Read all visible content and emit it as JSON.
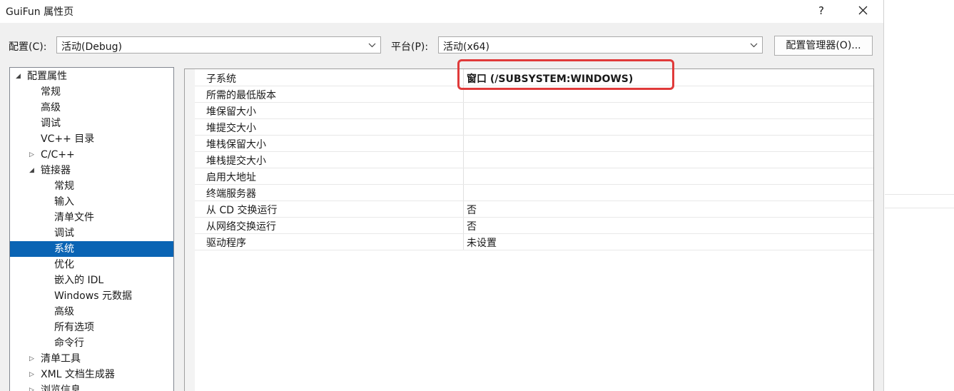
{
  "window": {
    "title": "GuiFun 属性页",
    "help_label": "?"
  },
  "toolbar": {
    "config_label": "配置(C):",
    "config_value": "活动(Debug)",
    "platform_label": "平台(P):",
    "platform_value": "活动(x64)",
    "manager_button": "配置管理器(O)..."
  },
  "tree": {
    "items": [
      {
        "label": "配置属性",
        "level": 0,
        "expander": "expanded"
      },
      {
        "label": "常规",
        "level": 1,
        "expander": "none"
      },
      {
        "label": "高级",
        "level": 1,
        "expander": "none"
      },
      {
        "label": "调试",
        "level": 1,
        "expander": "none"
      },
      {
        "label": "VC++ 目录",
        "level": 1,
        "expander": "none"
      },
      {
        "label": "C/C++",
        "level": 1,
        "expander": "collapsed"
      },
      {
        "label": "链接器",
        "level": 1,
        "expander": "expanded"
      },
      {
        "label": "常规",
        "level": 2,
        "expander": "none"
      },
      {
        "label": "输入",
        "level": 2,
        "expander": "none"
      },
      {
        "label": "清单文件",
        "level": 2,
        "expander": "none"
      },
      {
        "label": "调试",
        "level": 2,
        "expander": "none"
      },
      {
        "label": "系统",
        "level": 2,
        "expander": "none",
        "selected": true
      },
      {
        "label": "优化",
        "level": 2,
        "expander": "none"
      },
      {
        "label": "嵌入的 IDL",
        "level": 2,
        "expander": "none"
      },
      {
        "label": "Windows 元数据",
        "level": 2,
        "expander": "none"
      },
      {
        "label": "高级",
        "level": 2,
        "expander": "none"
      },
      {
        "label": "所有选项",
        "level": 2,
        "expander": "none"
      },
      {
        "label": "命令行",
        "level": 2,
        "expander": "none"
      },
      {
        "label": "清单工具",
        "level": 1,
        "expander": "collapsed"
      },
      {
        "label": "XML 文档生成器",
        "level": 1,
        "expander": "collapsed"
      },
      {
        "label": "浏览信息",
        "level": 1,
        "expander": "collapsed"
      }
    ]
  },
  "properties": {
    "rows": [
      {
        "name": "子系统",
        "value": "窗口 (/SUBSYSTEM:WINDOWS)",
        "bold": true
      },
      {
        "name": "所需的最低版本",
        "value": ""
      },
      {
        "name": "堆保留大小",
        "value": ""
      },
      {
        "name": "堆提交大小",
        "value": ""
      },
      {
        "name": "堆栈保留大小",
        "value": ""
      },
      {
        "name": "堆栈提交大小",
        "value": ""
      },
      {
        "name": "启用大地址",
        "value": ""
      },
      {
        "name": "终端服务器",
        "value": ""
      },
      {
        "name": "从 CD 交换运行",
        "value": "否"
      },
      {
        "name": "从网络交换运行",
        "value": "否"
      },
      {
        "name": "驱动程序",
        "value": "未设置"
      }
    ]
  },
  "colors": {
    "selection": "#0a64b4",
    "highlight_box": "#e03a3a"
  }
}
